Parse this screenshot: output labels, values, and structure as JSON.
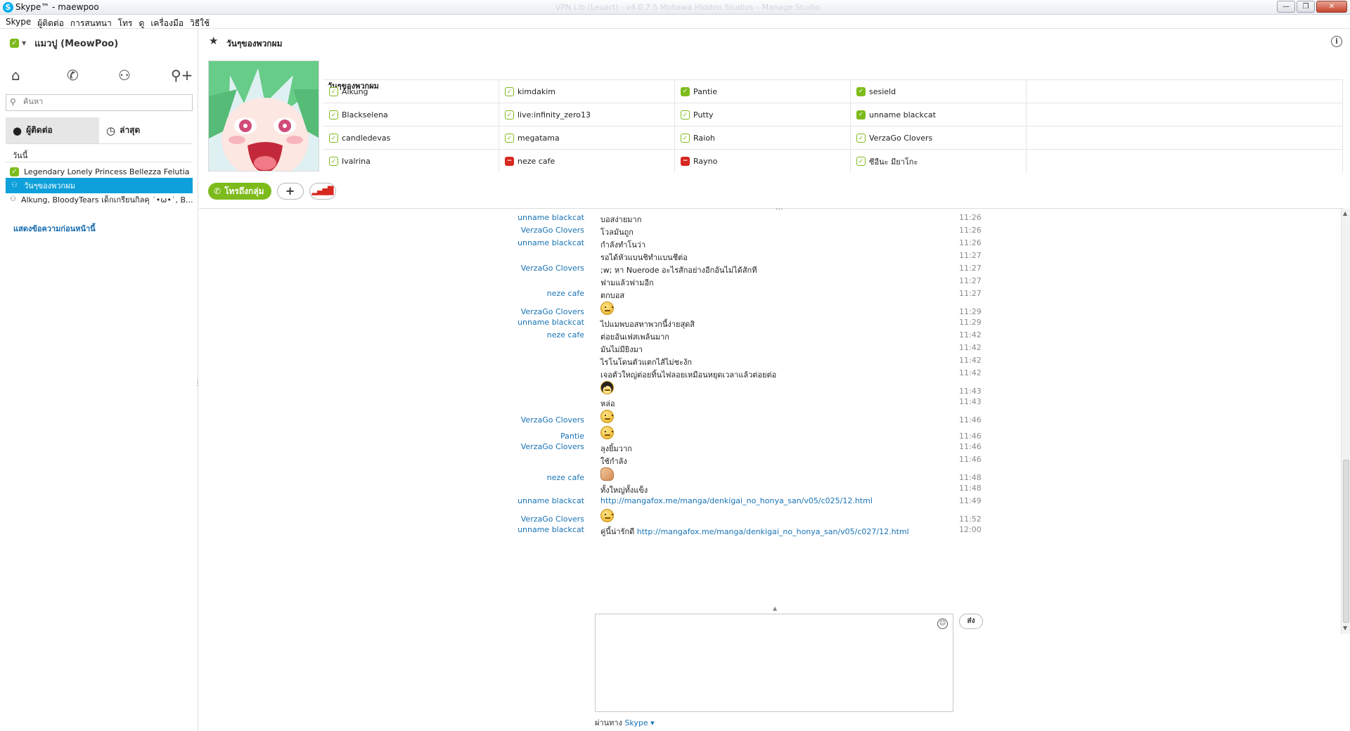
{
  "window": {
    "title": "Skype™ - maewpoo",
    "faded_title": "VPN Lib (Leuart) - v4.0.7.5 Mohawa Hidden Studios – Manage Studio",
    "btn_min": "—",
    "btn_max": "❐",
    "btn_close": "✕"
  },
  "menu": [
    "Skype",
    "ผู้ติดต่อ",
    "การสนทนา",
    "โทร",
    "ดู",
    "เครื่องมือ",
    "วิธีใช้"
  ],
  "profile": {
    "name": "แมวปู (MeowPoo)",
    "status": "online"
  },
  "nav_icons": [
    "home-icon",
    "phone-icon",
    "group-icon",
    "add-contact-icon"
  ],
  "search": {
    "placeholder": "ค้นหา"
  },
  "tabs": {
    "contacts": "ผู้ติดต่อ",
    "recent": "ล่าสุด"
  },
  "recent": {
    "section": "วันนี้",
    "items": [
      {
        "label": "Legendary Lonely Princess Bellezza Felutia",
        "icon": "online"
      },
      {
        "label": "วันๆของพวกผม",
        "icon": "group",
        "selected": true
      },
      {
        "label": "Alkung, BloodyTears เด็กเกรียนกิลคุ ˙•ω•˙, B...",
        "icon": "group"
      }
    ],
    "show_more": "แสดงข้อความก่อนหน้านี้"
  },
  "conversation": {
    "title": "วันๆของพวกผม",
    "participants_title": "วันๆของพวกผม",
    "participants": [
      [
        {
          "name": "Alkung",
          "status": "away"
        },
        {
          "name": "kimdakim",
          "status": "away"
        },
        {
          "name": "Pantie",
          "status": "online"
        },
        {
          "name": "sesield",
          "status": "online"
        }
      ],
      [
        {
          "name": "Blackselena",
          "status": "away"
        },
        {
          "name": "live:infinity_zero13",
          "status": "away"
        },
        {
          "name": "Putty",
          "status": "away"
        },
        {
          "name": "unname blackcat",
          "status": "online"
        }
      ],
      [
        {
          "name": "candledevas",
          "status": "away"
        },
        {
          "name": "megatama",
          "status": "away"
        },
        {
          "name": "Raioh",
          "status": "away"
        },
        {
          "name": "VerzaGo Clovers",
          "status": "away"
        }
      ],
      [
        {
          "name": "Ivalrina",
          "status": "away"
        },
        {
          "name": "neze cafe",
          "status": "busy"
        },
        {
          "name": "Rayno",
          "status": "busy"
        },
        {
          "name": "ซีอีนะ มียาโกะ",
          "status": "away"
        }
      ]
    ],
    "call_group_label": "โทรถึงกลุ่ม",
    "add_label": "+",
    "signal_label": "▂▄▆█",
    "dots": "...",
    "info": "i"
  },
  "messages": [
    {
      "sender": "unname blackcat",
      "text": "บอสง่ายมาก",
      "time": "11:26"
    },
    {
      "sender": "VerzaGo Clovers",
      "text": "โวลมันถูก",
      "time": "11:26"
    },
    {
      "sender": "unname blackcat",
      "text": "กำลังทำโนว่า",
      "time": "11:26"
    },
    {
      "sender": "",
      "text": "รอได้หัวแบนชิทำแบนชีต่อ",
      "time": "11:27"
    },
    {
      "sender": "VerzaGo Clovers",
      "text": ";w; หา Nuerode อะไรสักอย่างอีกอันไม่ได้สักที",
      "time": "11:27"
    },
    {
      "sender": "",
      "text": "ฟามแล้วฟามอีก",
      "time": "11:27"
    },
    {
      "sender": "neze cafe",
      "text": "ตกบอส",
      "time": "11:27"
    },
    {
      "sender": "VerzaGo Clovers",
      "emoticon": "worried",
      "time": "11:29"
    },
    {
      "sender": "unname blackcat",
      "text": "ไปแมพบอสหาพวกนี้ง่ายสุดสิ",
      "time": "11:29"
    },
    {
      "sender": "neze cafe",
      "text": "ต่อยอันเฟสเพล้นมาก",
      "time": "11:42"
    },
    {
      "sender": "",
      "text": "มันไม่มียิงมา",
      "time": "11:42"
    },
    {
      "sender": "",
      "text": "ไรโนโดนตัวแตกไส้ไม่ชะงัก",
      "time": "11:42"
    },
    {
      "sender": "",
      "text": "เจอตัวใหญ่ต่อยทิ้นไฟลอยเหมือนหยุดเวลาแล้วต่อยต่อ",
      "time": "11:42"
    },
    {
      "sender": "",
      "emoticon": "hair",
      "time": "11:43"
    },
    {
      "sender": "",
      "text": "หล่อ",
      "time": "11:43"
    },
    {
      "sender": "VerzaGo Clovers",
      "emoticon": "worried",
      "time": "11:46"
    },
    {
      "sender": "Pantie",
      "emoticon": "worried",
      "time": "11:46"
    },
    {
      "sender": "VerzaGo Clovers",
      "text": "ลุงยิ้มวาก",
      "time": "11:46"
    },
    {
      "sender": "",
      "text": "ใช้กำลัง",
      "time": "11:46"
    },
    {
      "sender": "neze cafe",
      "emoticon": "muscle",
      "time": "11:48"
    },
    {
      "sender": "",
      "text": "ทั้งใหญ่ทั้งแข็ง",
      "time": "11:48"
    },
    {
      "sender": "unname blackcat",
      "link": "http://mangafox.me/manga/denkigai_no_honya_san/v05/c025/12.html",
      "time": "11:49"
    },
    {
      "sender": "VerzaGo Clovers",
      "emoticon": "worried",
      "time": "11:52"
    },
    {
      "sender": "unname blackcat",
      "text": "คู่นี้น่ารักดี ",
      "link": "http://mangafox.me/manga/denkigai_no_honya_san/v05/c027/12.html",
      "time": "12:00"
    }
  ],
  "compose": {
    "send_label": "ส่ง",
    "via_label": "ผ่านทาง",
    "via_service": "Skype ▾"
  },
  "colors": {
    "accent": "#0ea0da",
    "online": "#7dbb1c",
    "busy": "#d7281f",
    "link": "#1773b5"
  }
}
